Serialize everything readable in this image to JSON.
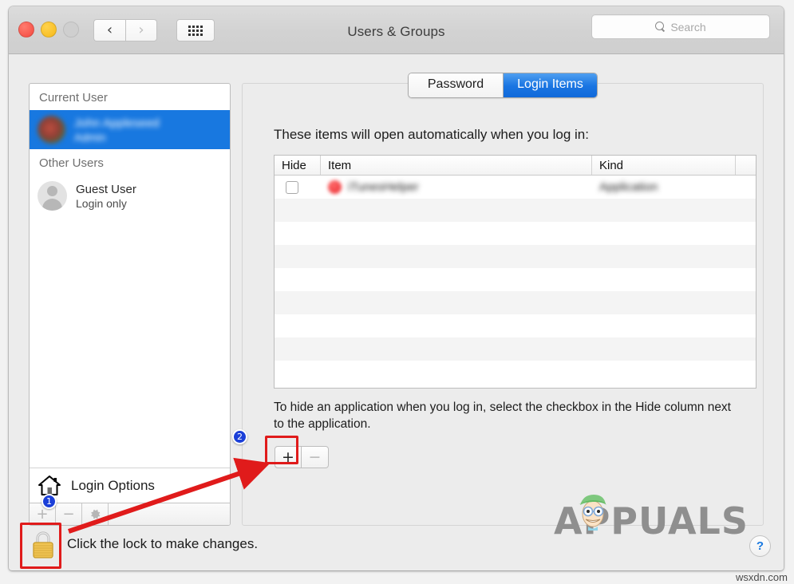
{
  "window": {
    "title": "Users & Groups",
    "traffic_lights": [
      "close-red",
      "minimize-yellow",
      "zoom-disabled"
    ],
    "back_glyph": "‹",
    "forward_glyph": "›",
    "grid_icon": "show-all-preferences-icon"
  },
  "search": {
    "placeholder": "Search",
    "value": "",
    "icon": "search-icon"
  },
  "sidebar": {
    "groups": [
      {
        "header": "Current User",
        "users": [
          {
            "name": "John Appleseed",
            "subtitle": "Admin",
            "selected": true,
            "blurred": true,
            "avatar": "photo-avatar"
          }
        ]
      },
      {
        "header": "Other Users",
        "users": [
          {
            "name": "Guest User",
            "subtitle": "Login only",
            "selected": false,
            "blurred": false,
            "avatar": "generic-person-avatar"
          }
        ]
      }
    ],
    "login_options_label": "Login Options",
    "login_options_icon": "house-icon",
    "toolbar": {
      "add_label": "+",
      "remove_label": "−",
      "gear_icon": "gear-icon",
      "enabled": false
    }
  },
  "pane": {
    "tabs": [
      {
        "label": "Password",
        "active": false
      },
      {
        "label": "Login Items",
        "active": true
      }
    ],
    "intro": "These items will open automatically when you log in:",
    "table": {
      "columns": [
        "Hide",
        "Item",
        "Kind"
      ],
      "rows": [
        {
          "hide_checked": false,
          "item": "iTunesHelper",
          "kind": "Application",
          "blurred": true,
          "icon": "itunes-app-icon"
        }
      ],
      "empty_row_count": 8
    },
    "hint": "To hide an application when you log in, select the checkbox in the Hide column next to the application.",
    "add_button_label": "+",
    "remove_button_label": "−",
    "remove_enabled": false
  },
  "footer": {
    "lock_icon": "closed-padlock-icon",
    "lock_text": "Click the lock to make changes.",
    "help_label": "?"
  },
  "annotations": {
    "badges": [
      {
        "id": "1",
        "label": "1",
        "target": "lock-icon"
      },
      {
        "id": "2",
        "label": "2",
        "target": "add-login-item-button"
      }
    ],
    "highlight_boxes": [
      "add-login-item-button",
      "lock-icon"
    ],
    "arrow": "red-arrow-from-lock-to-add-button",
    "accent_red": "#e01b1b",
    "accent_blue": "#1b3fd8"
  },
  "watermark": {
    "brand": "APPUALS",
    "site": "wsxdn.com"
  }
}
